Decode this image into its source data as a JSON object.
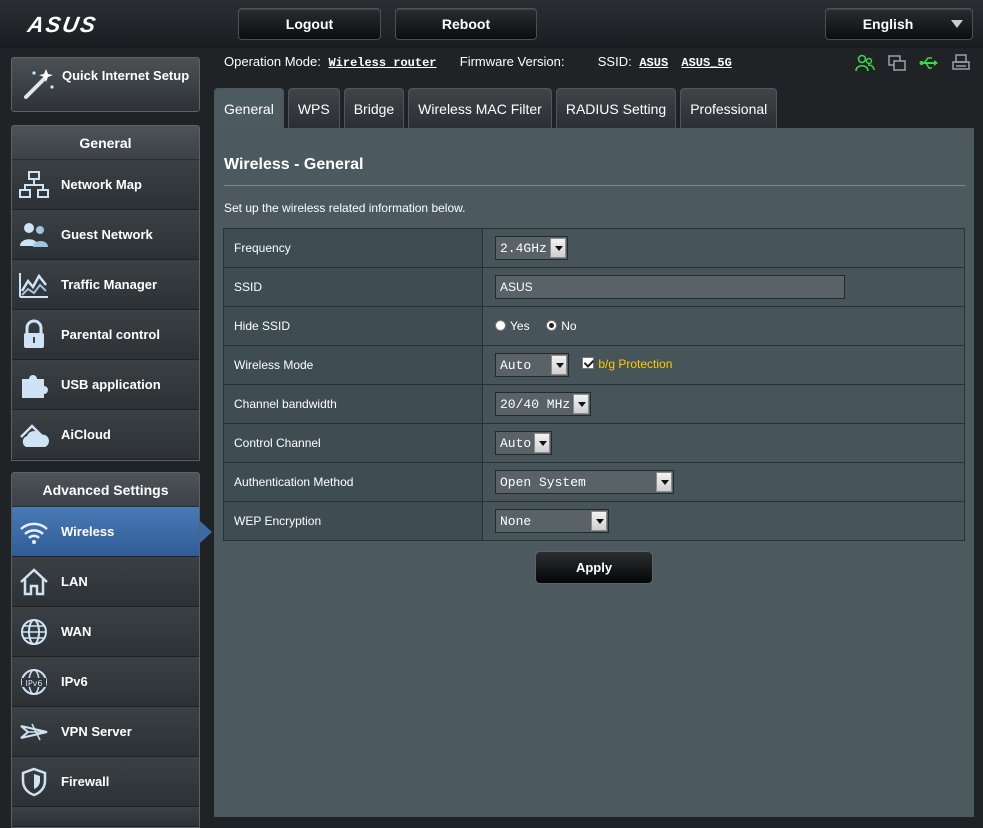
{
  "brand": {
    "logo_text": "ASUS"
  },
  "header": {
    "logout_label": "Logout",
    "reboot_label": "Reboot",
    "language": "English"
  },
  "status": {
    "op_mode_key": "Operation Mode:",
    "op_mode_value": "Wireless router",
    "firmware_key": "Firmware Version:",
    "firmware_value": "",
    "ssid_key": "SSID:",
    "ssid_1": "ASUS",
    "ssid_2": "ASUS_5G",
    "icons": [
      "client-status-icon",
      "network-status-icon",
      "usb-status-icon",
      "printer-status-icon"
    ]
  },
  "sidebar": {
    "quick_setup": "Quick Internet Setup",
    "general_title": "General",
    "general_items": [
      {
        "label": "Network Map",
        "icon": "network-map-icon"
      },
      {
        "label": "Guest Network",
        "icon": "guest-network-icon"
      },
      {
        "label": "Traffic Manager",
        "icon": "traffic-manager-icon"
      },
      {
        "label": "Parental control",
        "icon": "lock-icon"
      },
      {
        "label": "USB application",
        "icon": "puzzle-icon"
      },
      {
        "label": "AiCloud",
        "icon": "cloud-icon"
      }
    ],
    "advanced_title": "Advanced Settings",
    "advanced_items": [
      {
        "label": "Wireless",
        "icon": "wifi-icon",
        "active": true
      },
      {
        "label": "LAN",
        "icon": "home-icon"
      },
      {
        "label": "WAN",
        "icon": "globe-icon"
      },
      {
        "label": "IPv6",
        "icon": "ipv6-icon"
      },
      {
        "label": "VPN Server",
        "icon": "vpn-icon"
      },
      {
        "label": "Firewall",
        "icon": "shield-icon"
      }
    ]
  },
  "tabs": [
    "General",
    "WPS",
    "Bridge",
    "Wireless MAC Filter",
    "RADIUS Setting",
    "Professional"
  ],
  "active_tab": "General",
  "page": {
    "title": "Wireless - General",
    "description": "Set up the wireless related information below."
  },
  "form": {
    "frequency": {
      "label": "Frequency",
      "value": "2.4GHz"
    },
    "ssid": {
      "label": "SSID",
      "value": "ASUS"
    },
    "hide_ssid": {
      "label": "Hide SSID",
      "yes": "Yes",
      "no": "No",
      "selected": "No"
    },
    "wireless_mode": {
      "label": "Wireless Mode",
      "value": "Auto",
      "protection_label": "b/g Protection",
      "protection_checked": true
    },
    "channel_bandwidth": {
      "label": "Channel bandwidth",
      "value": "20/40 MHz"
    },
    "control_channel": {
      "label": "Control Channel",
      "value": "Auto"
    },
    "auth_method": {
      "label": "Authentication Method",
      "value": "Open System"
    },
    "wep": {
      "label": "WEP Encryption",
      "value": "None"
    }
  },
  "apply_label": "Apply",
  "colors": {
    "accent_active": "#3b6aa5",
    "warning_text": "#ffcc00",
    "status_green": "#3fd64b",
    "panel": "#4c5a60"
  }
}
